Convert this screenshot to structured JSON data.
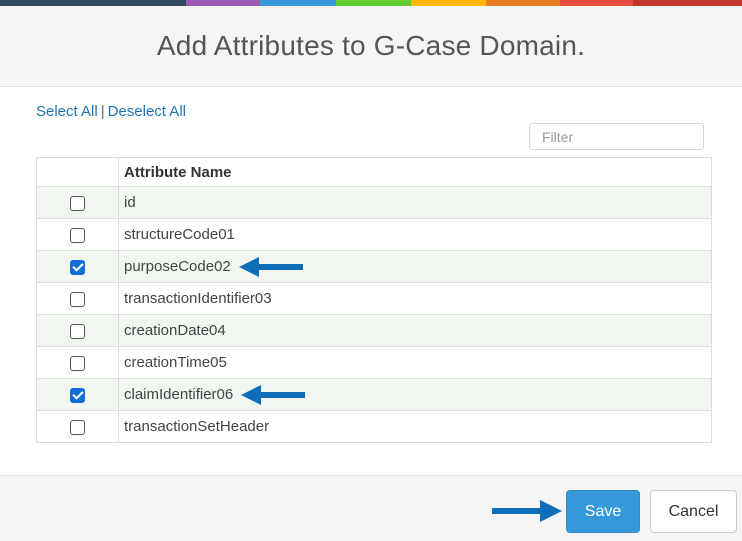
{
  "colorbar": [
    "#34495e",
    "#9b59b6",
    "#3498db",
    "#62cb31",
    "#ffb606",
    "#e67e22",
    "#e74c3c",
    "#c0392b"
  ],
  "dialog": {
    "title": "Add Attributes to G-Case Domain."
  },
  "selection": {
    "select_all": "Select All",
    "separator": "|",
    "deselect_all": "Deselect All"
  },
  "filter": {
    "placeholder": "Filter",
    "value": ""
  },
  "table": {
    "header": "Attribute Name",
    "rows": [
      {
        "name": "id",
        "checked": false
      },
      {
        "name": "structureCode01",
        "checked": false
      },
      {
        "name": "purposeCode02",
        "checked": true,
        "arrow": true
      },
      {
        "name": "transactionIdentifier03",
        "checked": false
      },
      {
        "name": "creationDate04",
        "checked": false
      },
      {
        "name": "creationTime05",
        "checked": false
      },
      {
        "name": "claimIdentifier06",
        "checked": true,
        "arrow": true
      },
      {
        "name": "transactionSetHeader",
        "checked": false
      }
    ]
  },
  "footer": {
    "save_label": "Save",
    "cancel_label": "Cancel",
    "arrow_color": "#0e6fb8"
  }
}
